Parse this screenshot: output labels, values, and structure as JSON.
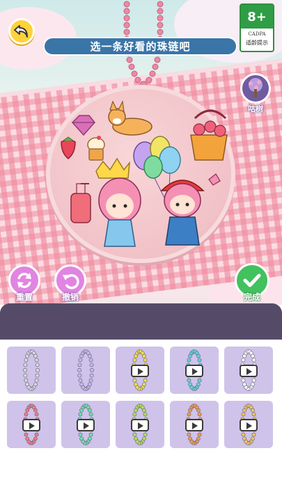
{
  "header": {
    "title": "选一条好看的珠链吧",
    "back_icon": "undo-arrow-icon"
  },
  "rating_badge": {
    "age": "8+",
    "org": "CADPA",
    "note": "适龄提示"
  },
  "tree": {
    "label": "咕树"
  },
  "actions": {
    "reset_label": "重置",
    "undo_label": "撤销",
    "done_label": "完成"
  },
  "chains": [
    {
      "color": "#d9d9e3",
      "locked": false
    },
    {
      "color": "#c9b7ef",
      "locked": false
    },
    {
      "color": "#f5e04a",
      "locked": true
    },
    {
      "color": "#5fd3df",
      "locked": true
    },
    {
      "color": "#ffffff",
      "locked": true
    },
    {
      "color": "#f07a8a",
      "locked": true
    },
    {
      "color": "#6ee0b3",
      "locked": true
    },
    {
      "color": "#b3e25a",
      "locked": true
    },
    {
      "color": "#f39a4d",
      "locked": true
    },
    {
      "color": "#f7c65a",
      "locked": true
    }
  ],
  "colors": {
    "title_bg": "#3a75a8",
    "action_purple": "#e184e2",
    "done_green": "#42c15f",
    "cell_bg": "#cfc3ea"
  }
}
